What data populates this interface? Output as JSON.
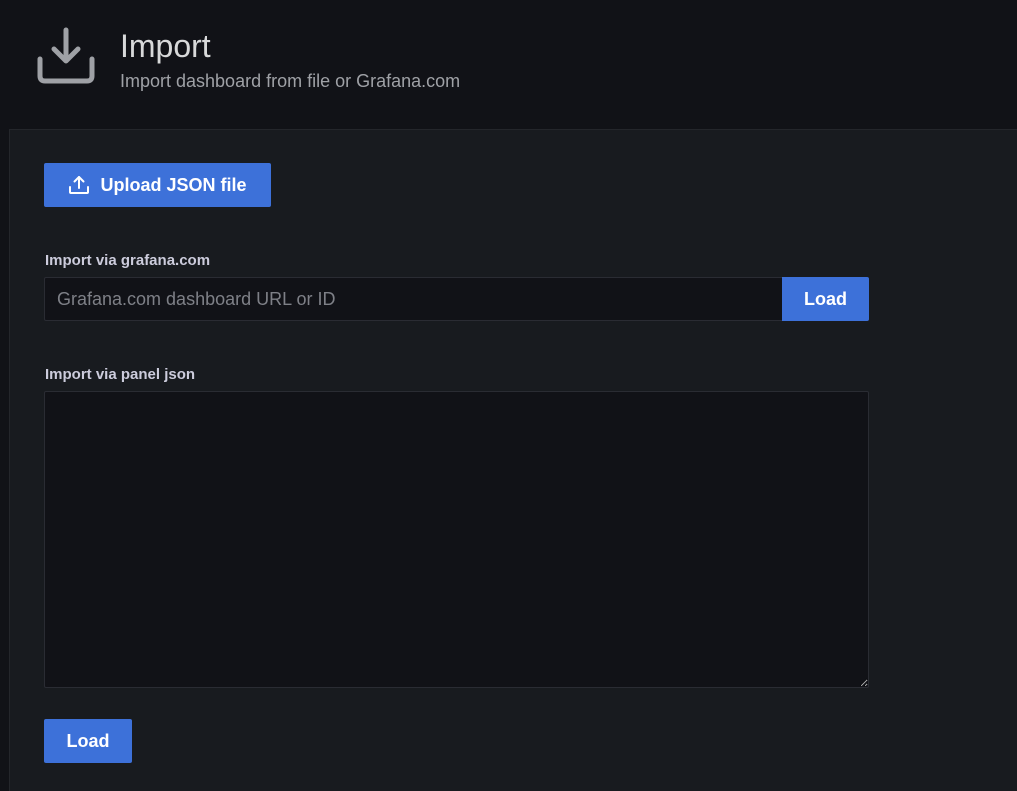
{
  "header": {
    "title": "Import",
    "subtitle": "Import dashboard from file or Grafana.com",
    "icon": "import-download-icon"
  },
  "upload": {
    "label": "Upload JSON file",
    "icon": "upload-icon"
  },
  "grafana_import": {
    "label": "Import via grafana.com",
    "input_value": "",
    "placeholder": "Grafana.com dashboard URL or ID",
    "button_label": "Load"
  },
  "panel_json": {
    "label": "Import via panel json",
    "value": "",
    "button_label": "Load"
  },
  "colors": {
    "accent": "#3d71d9",
    "background": "#111217",
    "panel": "#181b1f",
    "text": "#d8d9da",
    "muted_text": "#9fa1a6"
  }
}
